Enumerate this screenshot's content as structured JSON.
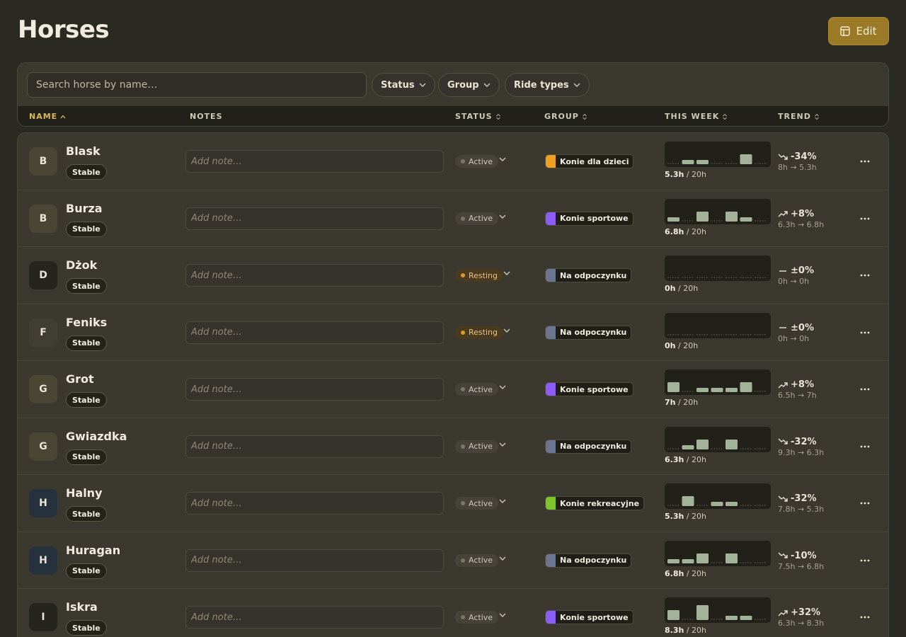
{
  "page": {
    "title": "Horses",
    "edit_label": "Edit"
  },
  "filters": {
    "search_placeholder": "Search horse by name…",
    "status_label": "Status",
    "group_label": "Group",
    "ride_types_label": "Ride types"
  },
  "columns": {
    "name": "NAME",
    "notes": "NOTES",
    "status": "STATUS",
    "group": "GROUP",
    "this_week": "THIS WEEK",
    "trend": "TREND"
  },
  "colors": {
    "accent": "#9a7a26",
    "bar": "#a3b39a",
    "active_dot": "#7c7868",
    "resting_dot": "#d99a2b",
    "group_dzieci": "#f0a020",
    "group_sportowe": "#8b5cf6",
    "group_odpoczynku": "#6b7590",
    "group_rekreacyjne": "#7ec32a"
  },
  "note_placeholder": "Add note…",
  "horses": [
    {
      "initial": "B",
      "avatar_color": "#4b4634",
      "name": "Blask",
      "badge": "Stable",
      "status": "Active",
      "group": "Konie dla dzieci",
      "group_color": "#f0a020",
      "week_hours": "5.3h",
      "week_goal": "/ 20h",
      "bars": [
        0,
        1,
        1,
        0,
        0,
        2.3,
        0
      ],
      "trend_dir": "down",
      "trend_pct": "-34%",
      "trend_range": "8h → 5.3h"
    },
    {
      "initial": "B",
      "avatar_color": "#4b4634",
      "name": "Burza",
      "badge": "Stable",
      "status": "Active",
      "group": "Konie sportowe",
      "group_color": "#8b5cf6",
      "week_hours": "6.8h",
      "week_goal": "/ 20h",
      "bars": [
        1,
        0,
        2.3,
        0,
        2.3,
        1,
        0
      ],
      "trend_dir": "up",
      "trend_pct": "+8%",
      "trend_range": "6.3h → 6.8h"
    },
    {
      "initial": "D",
      "avatar_color": "#25241d",
      "name": "Dżok",
      "badge": "Stable",
      "status": "Resting",
      "group": "Na odpoczynku",
      "group_color": "#6b7590",
      "week_hours": "0h",
      "week_goal": "/ 20h",
      "bars": [
        0,
        0,
        0,
        0,
        0,
        0,
        0
      ],
      "trend_dir": "flat",
      "trend_pct": "±0%",
      "trend_range": "0h → 0h"
    },
    {
      "initial": "F",
      "avatar_color": "#3f3d34",
      "name": "Feniks",
      "badge": "Stable",
      "status": "Resting",
      "group": "Na odpoczynku",
      "group_color": "#6b7590",
      "week_hours": "0h",
      "week_goal": "/ 20h",
      "bars": [
        0,
        0,
        0,
        0,
        0,
        0,
        0
      ],
      "trend_dir": "flat",
      "trend_pct": "±0%",
      "trend_range": "0h → 0h"
    },
    {
      "initial": "G",
      "avatar_color": "#4b4634",
      "name": "Grot",
      "badge": "Stable",
      "status": "Active",
      "group": "Konie sportowe",
      "group_color": "#8b5cf6",
      "week_hours": "7h",
      "week_goal": "/ 20h",
      "bars": [
        2.3,
        0,
        1,
        1,
        1,
        2.3,
        0
      ],
      "trend_dir": "up",
      "trend_pct": "+8%",
      "trend_range": "6.5h → 7h"
    },
    {
      "initial": "G",
      "avatar_color": "#4b4634",
      "name": "Gwiazdka",
      "badge": "Stable",
      "status": "Active",
      "group": "Na odpoczynku",
      "group_color": "#6b7590",
      "week_hours": "6.3h",
      "week_goal": "/ 20h",
      "bars": [
        0,
        1,
        2.3,
        0,
        2.3,
        0,
        0
      ],
      "trend_dir": "down",
      "trend_pct": "-32%",
      "trend_range": "9.3h → 6.3h"
    },
    {
      "initial": "H",
      "avatar_color": "#25313d",
      "name": "Halny",
      "badge": "Stable",
      "status": "Active",
      "group": "Konie rekreacyjne",
      "group_color": "#7ec32a",
      "week_hours": "5.3h",
      "week_goal": "/ 20h",
      "bars": [
        0,
        2.3,
        0,
        1,
        1,
        0,
        0
      ],
      "trend_dir": "down",
      "trend_pct": "-32%",
      "trend_range": "7.8h → 5.3h"
    },
    {
      "initial": "H",
      "avatar_color": "#25313d",
      "name": "Huragan",
      "badge": "Stable",
      "status": "Active",
      "group": "Na odpoczynku",
      "group_color": "#6b7590",
      "week_hours": "6.8h",
      "week_goal": "/ 20h",
      "bars": [
        1,
        1,
        2.3,
        0,
        2.3,
        0,
        0
      ],
      "trend_dir": "down",
      "trend_pct": "-10%",
      "trend_range": "7.5h → 6.8h"
    },
    {
      "initial": "I",
      "avatar_color": "#25241d",
      "name": "Iskra",
      "badge": "Stable",
      "status": "Active",
      "group": "Konie sportowe",
      "group_color": "#8b5cf6",
      "week_hours": "8.3h",
      "week_goal": "/ 20h",
      "bars": [
        2.3,
        0,
        3.5,
        0,
        1,
        1,
        0
      ],
      "trend_dir": "up",
      "trend_pct": "+32%",
      "trend_range": "6.3h → 8.3h"
    }
  ]
}
